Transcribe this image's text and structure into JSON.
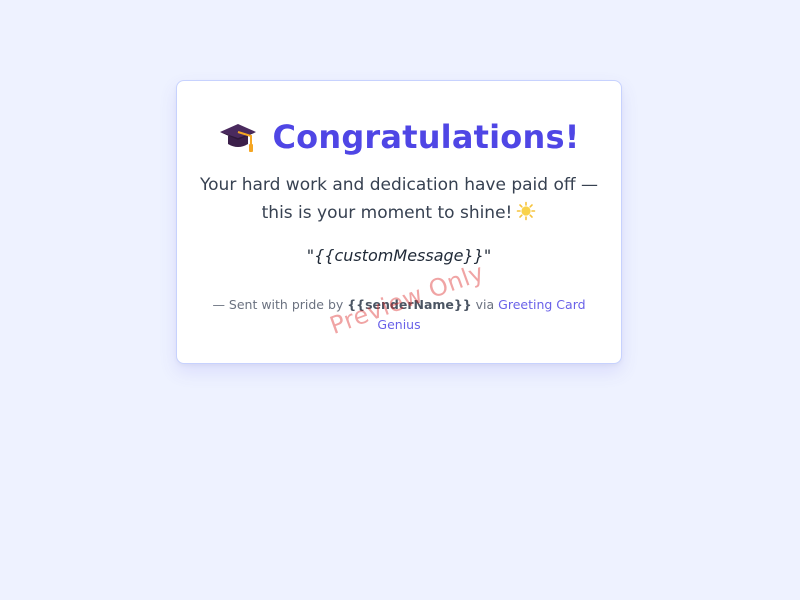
{
  "card": {
    "title": "Congratulations!",
    "icon": "graduation-cap-icon",
    "message_line1": "Your hard work and dedication have paid off —",
    "message_line2": "this is your moment to shine!",
    "message_icon": "sun-icon",
    "custom_message": "{{customMessage}}",
    "quote_open": "\"",
    "quote_close": "\"",
    "footer_prefix": "— Sent with pride by ",
    "sender_name": "{{senderName}}",
    "footer_via": " via ",
    "link_text": "Greeting Card Genius",
    "watermark": "Preview Only"
  },
  "colors": {
    "background": "#eef2ff",
    "accent": "#4f46e5",
    "watermark": "#dc2626"
  }
}
